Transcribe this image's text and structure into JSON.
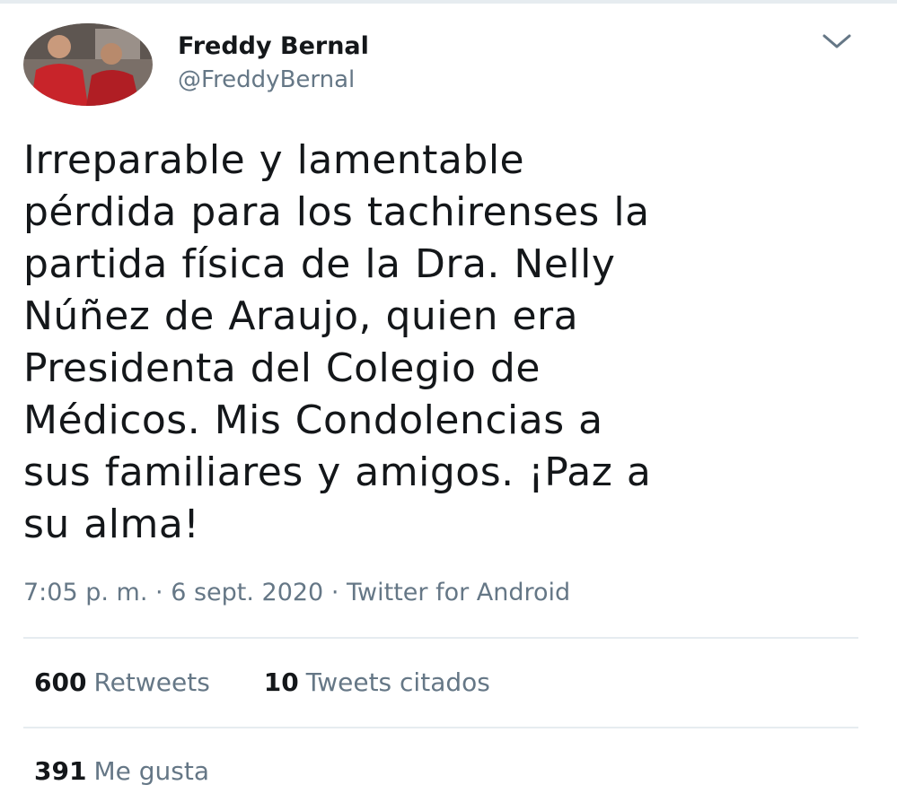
{
  "tweet": {
    "author": {
      "name": "Freddy Bernal",
      "handle": "@FreddyBernal"
    },
    "lines": [
      "Irreparable y lamentable",
      "pérdida para los tachirenses la",
      "partida física de la Dra. Nelly",
      "Núñez de Araujo, quien era",
      "Presidenta del Colegio de",
      "Médicos. Mis Condolencias a",
      "sus familiares y amigos. ¡Paz a",
      "su alma!"
    ],
    "time": "7:05 p. m.",
    "separator": "·",
    "date": "6 sept. 2020",
    "source": "Twitter for Android",
    "stats": {
      "retweets": {
        "count": "600",
        "label": "Retweets"
      },
      "quotes": {
        "count": "10",
        "label": "Tweets citados"
      },
      "likes": {
        "count": "391",
        "label": "Me gusta"
      }
    }
  },
  "icons": {
    "more": "chevron-down-icon"
  },
  "colors": {
    "text": "#14171a",
    "secondary": "#657786",
    "divider": "#e6ecf0"
  }
}
